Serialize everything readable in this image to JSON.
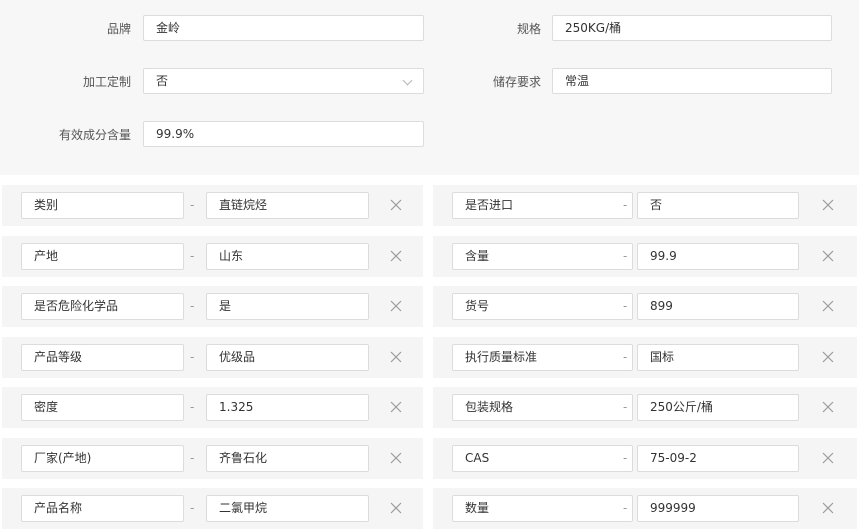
{
  "top_form": {
    "brand": {
      "label": "品牌",
      "value": "金岭"
    },
    "spec": {
      "label": "规格",
      "value": "250KG/桶"
    },
    "custom": {
      "label": "加工定制",
      "value": "否"
    },
    "storage": {
      "label": "储存要求",
      "value": "常温"
    },
    "content": {
      "label": "有效成分含量",
      "value": "99.9%"
    }
  },
  "attributes": {
    "left": [
      {
        "name": "类别",
        "value": "直链烷烃"
      },
      {
        "name": "产地",
        "value": "山东"
      },
      {
        "name": "是否危险化学品",
        "value": "是"
      },
      {
        "name": "产品等级",
        "value": "优级品"
      },
      {
        "name": "密度",
        "value": "1.325"
      },
      {
        "name": "厂家(产地)",
        "value": "齐鲁石化"
      },
      {
        "name": "产品名称",
        "value": "二氯甲烷"
      }
    ],
    "right": [
      {
        "name": "是否进口",
        "value": "否"
      },
      {
        "name": "含量",
        "value": "99.9"
      },
      {
        "name": "货号",
        "value": "899"
      },
      {
        "name": "执行质量标准",
        "value": "国标"
      },
      {
        "name": "包装规格",
        "value": "250公斤/桶"
      },
      {
        "name": "CAS",
        "value": "75-09-2"
      },
      {
        "name": "数量",
        "value": "999999"
      }
    ],
    "separator": "-"
  },
  "icons": {
    "delete": "close-icon",
    "dropdown": "chevron-down-icon"
  }
}
